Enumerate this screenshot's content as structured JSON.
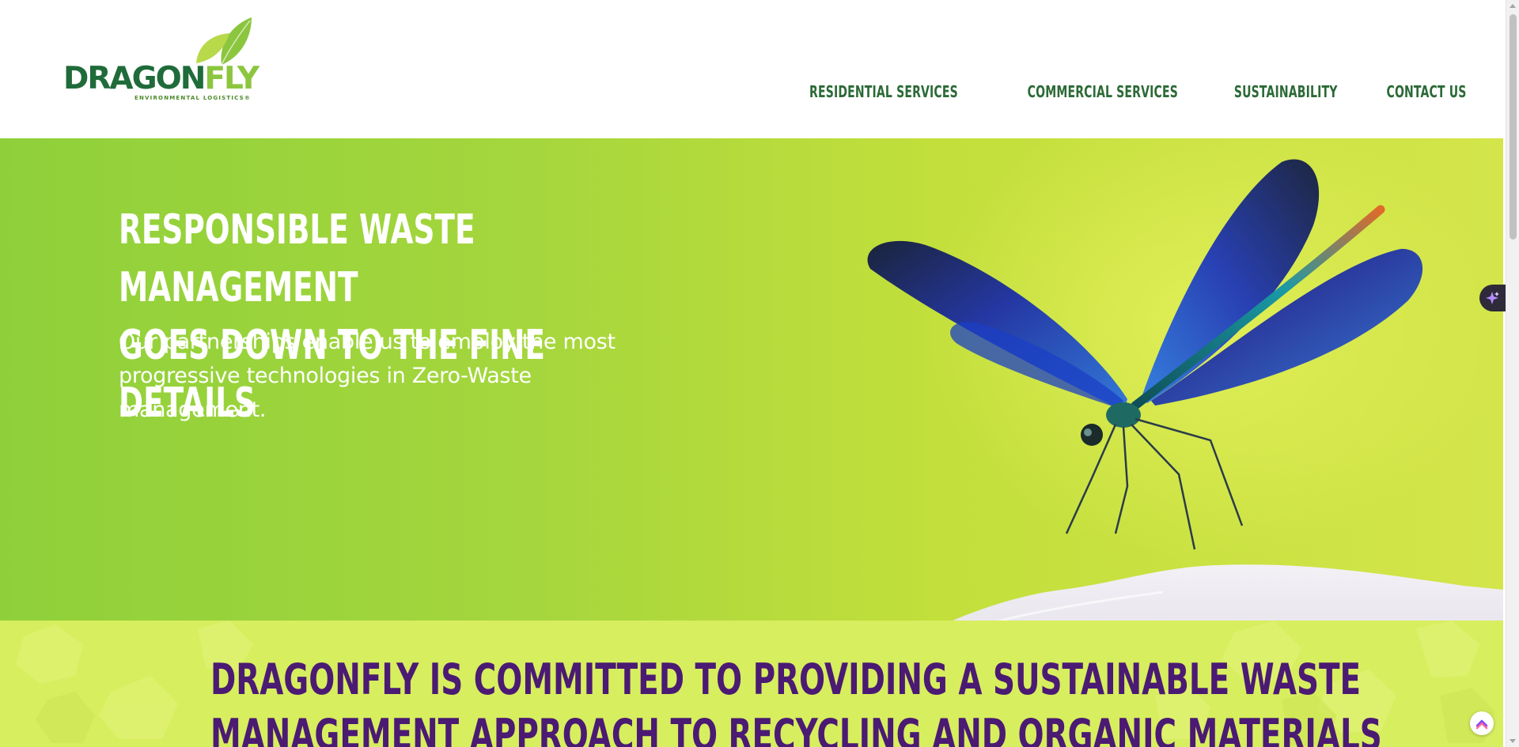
{
  "brand": {
    "name_part1": "DRAGON",
    "name_part2": "FLY",
    "tagline": "ENVIRONMENTAL LOGISTICS®",
    "primary_color": "#1f6b3a",
    "accent_color": "#8cc63f"
  },
  "nav": {
    "items": [
      {
        "label": "RESIDENTIAL SERVICES"
      },
      {
        "label": "COMMERCIAL SERVICES"
      },
      {
        "label": "SUSTAINABILITY"
      },
      {
        "label": "CONTACT US"
      }
    ],
    "color": "#2b6a36"
  },
  "hero": {
    "title_line1": "RESPONSIBLE WASTE MANAGEMENT",
    "title_line2": "GOES DOWN TO THE FINE DETAILS",
    "subtitle": "Our partnerships enable us to employ the most progressive technologies in Zero-Waste management.",
    "image": "dragonfly-on-rock",
    "background_color": "#a5d63d"
  },
  "commitment": {
    "line1": "DRAGONFLY IS COMMITTED TO PROVIDING A SUSTAINABLE WASTE",
    "line2": "MANAGEMENT APPROACH TO RECYCLING AND ORGANIC MATERIALS",
    "text_color": "#4b1a73",
    "background_color": "#d7ee5f"
  },
  "widgets": {
    "ai_assistant_icon": "sparkle-icon",
    "help_icon": "chat-help-icon"
  }
}
